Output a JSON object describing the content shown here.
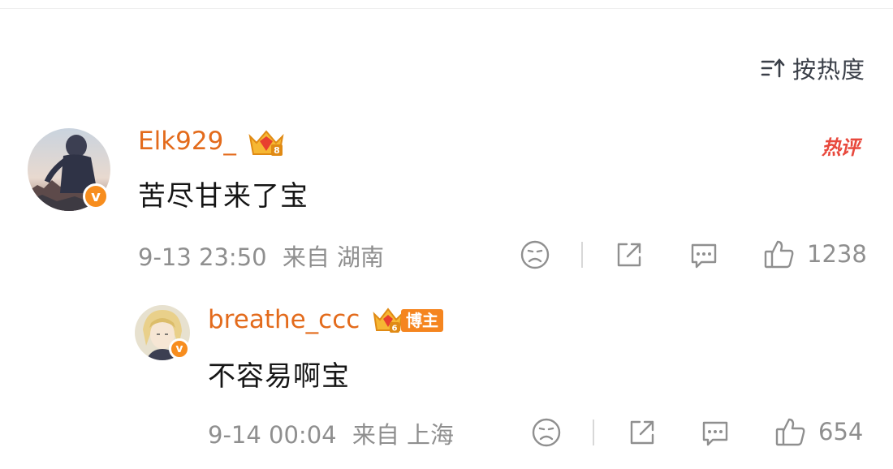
{
  "sort": {
    "label": "按热度"
  },
  "comment": {
    "username": "Elk929_",
    "crown_level": "8",
    "hot_label": "热评",
    "text": "苦尽甘来了宝",
    "time": "9-13 23:50",
    "location": "来自 湖南",
    "likes": "1238"
  },
  "reply": {
    "username": "breathe_ccc",
    "crown_level": "6",
    "owner_tag": "博主",
    "text": "不容易啊宝",
    "time": "9-14 00:04",
    "location": "来自 上海",
    "likes": "654"
  },
  "verified_badge": "v",
  "colors": {
    "username": "#e36b1c",
    "badge": "#f78d1e",
    "hot": "#e8493d",
    "meta": "#8f8f8f"
  },
  "icons": [
    "sort-icon",
    "emoji-icon",
    "share-icon",
    "comment-icon",
    "like-icon",
    "crown-icon",
    "verified-badge-icon"
  ]
}
